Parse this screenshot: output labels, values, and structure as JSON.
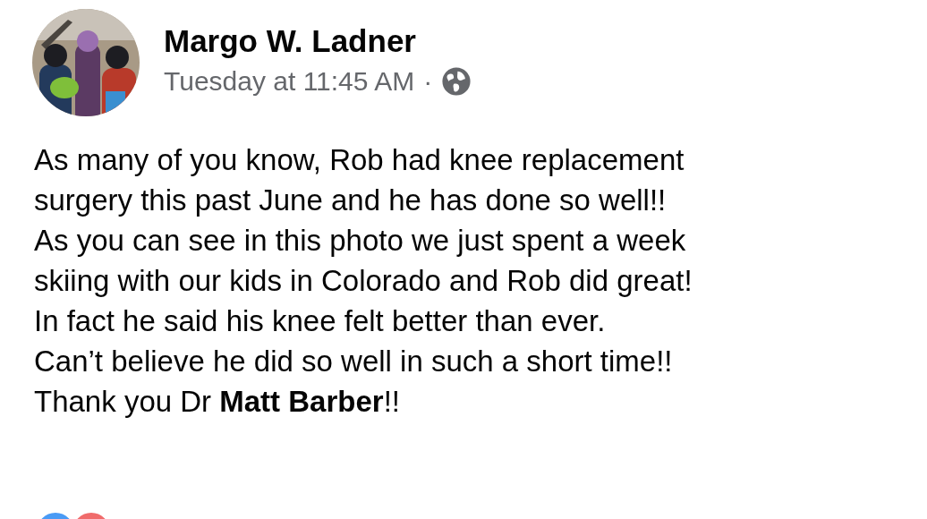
{
  "post": {
    "author": "Margo W. Ladner",
    "time": "Tuesday at 11:45 AM",
    "separator": "·",
    "text": "As many of you know, Rob had knee replacement\nsurgery this past June and he has done so well!!\nAs you can see in this photo we just spent a week\nskiing with our kids in Colorado and Rob did great!\nIn fact he said his knee felt better than ever.\nCan’t believe he did so well in such a short time!!\nThank you Dr **Matt Barber**!!"
  }
}
